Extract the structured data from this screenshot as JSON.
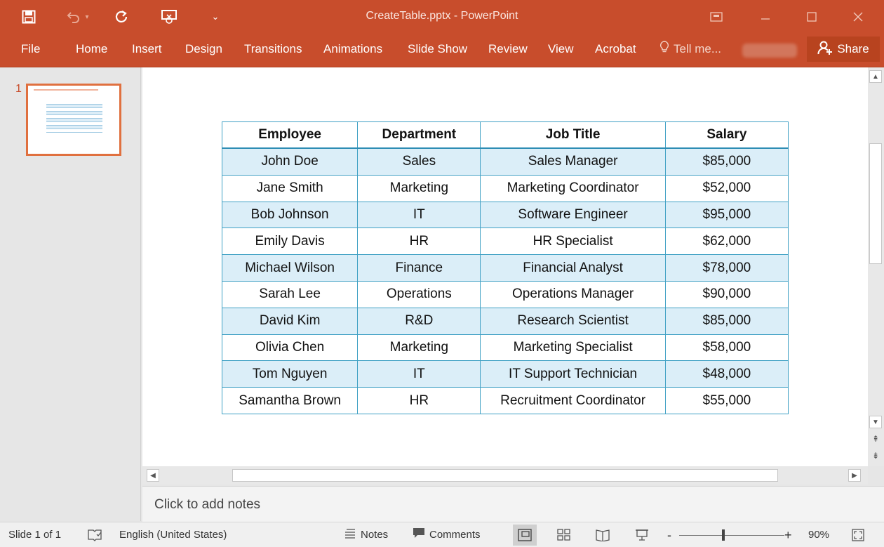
{
  "window": {
    "title": "CreateTable.pptx - PowerPoint"
  },
  "ribbon": {
    "tabs": [
      "File",
      "Home",
      "Insert",
      "Design",
      "Transitions",
      "Animations",
      "Slide Show",
      "Review",
      "View",
      "Acrobat"
    ],
    "tell_me": "Tell me...",
    "share": "Share"
  },
  "thumbnails": {
    "slide_number": "1"
  },
  "table": {
    "headers": [
      "Employee",
      "Department",
      "Job Title",
      "Salary"
    ],
    "rows": [
      [
        "John Doe",
        "Sales",
        "Sales Manager",
        "$85,000"
      ],
      [
        "Jane Smith",
        "Marketing",
        "Marketing Coordinator",
        "$52,000"
      ],
      [
        "Bob Johnson",
        "IT",
        "Software Engineer",
        "$95,000"
      ],
      [
        "Emily Davis",
        "HR",
        "HR Specialist",
        "$62,000"
      ],
      [
        "Michael Wilson",
        "Finance",
        "Financial Analyst",
        "$78,000"
      ],
      [
        "Sarah Lee",
        "Operations",
        "Operations Manager",
        "$90,000"
      ],
      [
        "David Kim",
        "R&D",
        "Research Scientist",
        "$85,000"
      ],
      [
        "Olivia Chen",
        "Marketing",
        "Marketing Specialist",
        "$58,000"
      ],
      [
        "Tom Nguyen",
        "IT",
        "IT Support Technician",
        "$48,000"
      ],
      [
        "Samantha Brown",
        "HR",
        "Recruitment Coordinator",
        "$55,000"
      ]
    ]
  },
  "notes": {
    "placeholder": "Click to add notes"
  },
  "status": {
    "slide_info": "Slide 1 of 1",
    "language": "English (United States)",
    "notes_label": "Notes",
    "comments_label": "Comments",
    "zoom_minus": "-",
    "zoom_plus": "+",
    "zoom_level": "90%"
  },
  "colors": {
    "accent": "#c84d2c",
    "table_border": "#3fa0c4",
    "table_band": "#dbeef8"
  }
}
